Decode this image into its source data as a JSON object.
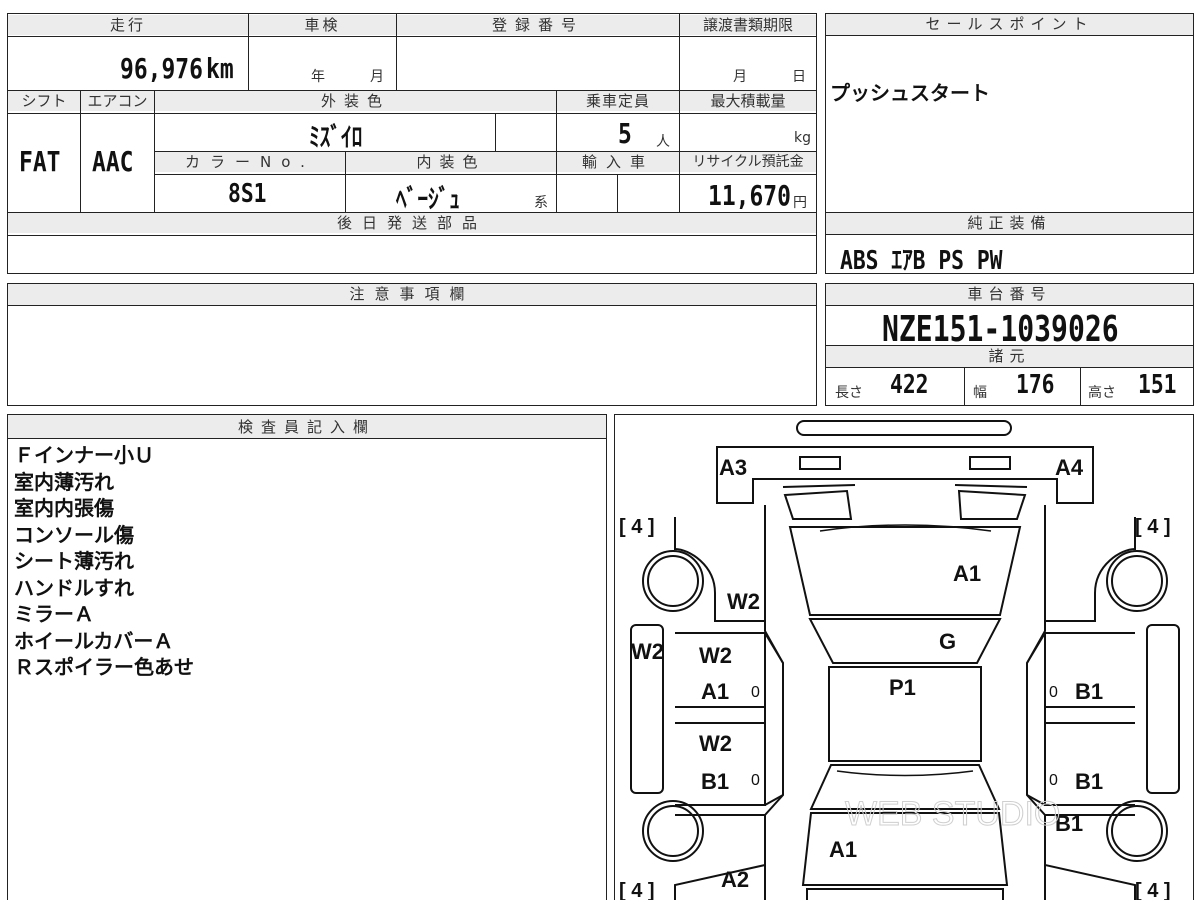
{
  "vehicle_info": {
    "mileage_label": "走行",
    "mileage_value": "96,976",
    "mileage_unit": "km",
    "inspection_label": "車検",
    "inspection_year_unit": "年",
    "inspection_month_unit": "月",
    "registration_label": "登録番号",
    "transfer_label": "譲渡書類期限",
    "transfer_month_unit": "月",
    "transfer_day_unit": "日",
    "shift_label": "シフト",
    "shift_value": "FAT",
    "aircon_label": "エアコン",
    "aircon_value": "AAC",
    "exterior_color_label": "外装色",
    "exterior_color_value": "ﾐｽﾞｲﾛ",
    "capacity_label": "乗車定員",
    "capacity_value": "5",
    "capacity_unit": "人",
    "max_load_label": "最大積載量",
    "max_load_unit": "kg",
    "color_no_label": "カラーNo.",
    "color_no_value": "8S1",
    "interior_color_label": "内装色",
    "interior_color_value": "ﾍﾞｰｼﾞｭ",
    "interior_color_suffix": "系",
    "import_label": "輸入車",
    "recycle_label": "リサイクル預託金",
    "recycle_value": "11,670",
    "recycle_unit": "円",
    "later_parts_label": "後日発送部品"
  },
  "sales_point": {
    "label": "セールスポイント",
    "text": "プッシュスタート"
  },
  "standard_equipment": {
    "label": "純正装備",
    "text": "ABS ｴｱB PS PW"
  },
  "notes": {
    "label": "注意事項欄"
  },
  "chassis": {
    "label": "車台番号",
    "value": "NZE151-1039026",
    "specs_label": "諸元",
    "length_label": "長さ",
    "length_value": "422",
    "width_label": "幅",
    "width_value": "176",
    "height_label": "高さ",
    "height_value": "151"
  },
  "inspector": {
    "label": "検査員記入欄",
    "remarks": [
      "Ｆインナー小Ｕ",
      "室内薄汚れ",
      "室内内張傷",
      "コンソール傷",
      "シート薄汚れ",
      "ハンドルすれ",
      "ミラーＡ",
      "ホイールカバーＡ",
      "Ｒスポイラー色あせ"
    ]
  },
  "diagram": {
    "tire_fl": "4",
    "tire_fr": "4",
    "tire_rl": "4",
    "tire_rr": "4",
    "codes": {
      "front_left_corner": "A3",
      "front_right_corner": "A4",
      "hood": "A1",
      "left_front_fender": "W2",
      "left_rocker": "W2",
      "windshield": "G",
      "roof": "P1",
      "left_front_door_top": "W2",
      "left_front_door_bottom": "A1",
      "left_rear_door_top": "W2",
      "left_rear_door_bottom": "B1",
      "right_front_door": "B1",
      "right_rear_door": "B1",
      "right_rear_fender": "B1",
      "trunk": "A1",
      "rear_left_corner": "A2"
    },
    "door_marks": [
      "0",
      "0",
      "0",
      "0"
    ],
    "watermark": "WEB STUDIO"
  }
}
